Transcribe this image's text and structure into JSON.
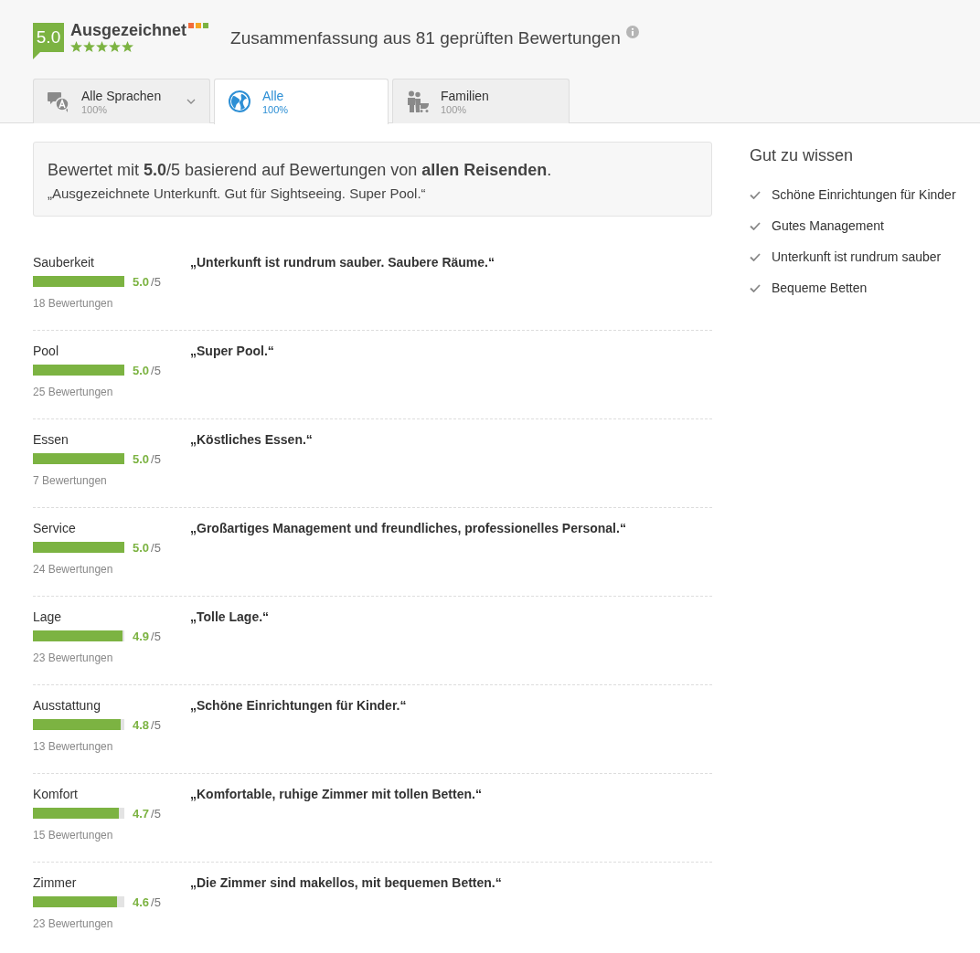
{
  "header": {
    "score": "5.0",
    "rating_label": "Ausgezeichnet",
    "stars": 5,
    "summary_title": "Zusammenfassung aus 81 geprüften Bewertungen"
  },
  "tabs": [
    {
      "kind": "languages",
      "label": "Alle Sprachen",
      "share": "100%",
      "selected": false,
      "dropdown": true
    },
    {
      "kind": "globe",
      "label": "Alle",
      "share": "100%",
      "selected": true,
      "dropdown": false
    },
    {
      "kind": "family",
      "label": "Familien",
      "share": "100%",
      "selected": false,
      "dropdown": false
    }
  ],
  "summary": {
    "text": "Bewertet mit **5.0**/5 basierend auf Bewertungen von **allen Reisenden**.",
    "quote": "„Ausgezeichnete Unterkunft. Gut für Sightseeing. Super Pool.“"
  },
  "categories": [
    {
      "name": "Sauberkeit",
      "level": 1.0,
      "score": "5.0",
      "max": "/5",
      "count": "18 Bewertungen",
      "quote": "„Unterkunft ist rundrum sauber. Saubere Räume.“"
    },
    {
      "name": "Pool",
      "level": 1.0,
      "score": "5.0",
      "max": "/5",
      "count": "25 Bewertungen",
      "quote": "„Super Pool.“"
    },
    {
      "name": "Essen",
      "level": 1.0,
      "score": "5.0",
      "max": "/5",
      "count": "7 Bewertungen",
      "quote": "„Köstliches Essen.“"
    },
    {
      "name": "Service",
      "level": 1.0,
      "score": "5.0",
      "max": "/5",
      "count": "24 Bewertungen",
      "quote": "„Großartiges Management und freundliches, professionelles Personal.“"
    },
    {
      "name": "Lage",
      "level": 0.98,
      "score": "4.9",
      "max": "/5",
      "count": "23 Bewertungen",
      "quote": "„Tolle Lage.“"
    },
    {
      "name": "Ausstattung",
      "level": 0.96,
      "score": "4.8",
      "max": "/5",
      "count": "13 Bewertungen",
      "quote": "„Schöne Einrichtungen für Kinder.“"
    },
    {
      "name": "Komfort",
      "level": 0.94,
      "score": "4.7",
      "max": "/5",
      "count": "15 Bewertungen",
      "quote": "„Komfortable, ruhige Zimmer mit tollen Betten.“"
    },
    {
      "name": "Zimmer",
      "level": 0.92,
      "score": "4.6",
      "max": "/5",
      "count": "23 Bewertungen",
      "quote": "„Die Zimmer sind makellos, mit bequemen Betten.“"
    }
  ],
  "good_to_know": {
    "title": "Gut zu wissen",
    "items": [
      "Schöne Einrichtungen für Kinder",
      "Gutes Management",
      "Unterkunft ist rundrum sauber",
      "Bequeme Betten"
    ]
  }
}
